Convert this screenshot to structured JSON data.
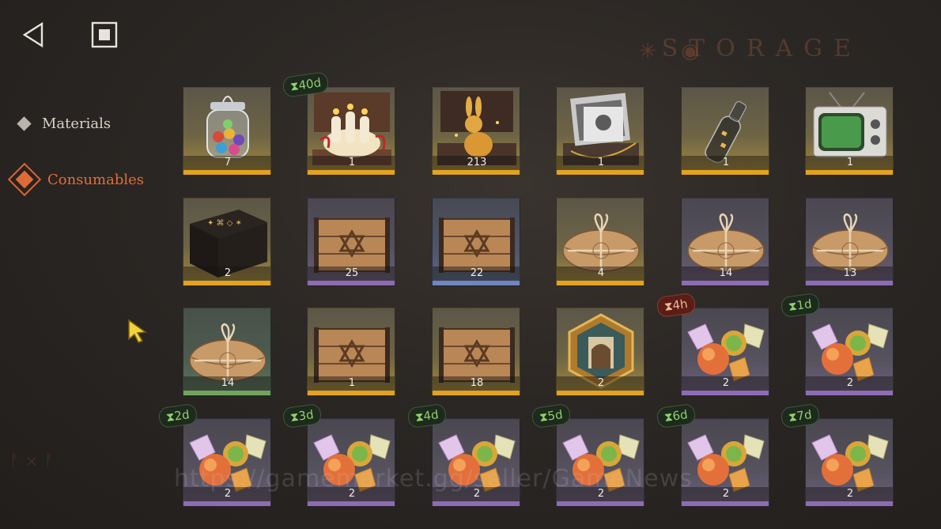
{
  "header": {
    "back_icon": "back-triangle-icon",
    "home_icon": "square-stop-icon",
    "title": "STORAGE"
  },
  "sidebar": {
    "items": [
      {
        "label": "Materials",
        "active": false
      },
      {
        "label": "Consumables",
        "active": true
      }
    ]
  },
  "colors": {
    "accent": "#e46d37",
    "rarity_gold": "#e3a21f",
    "rarity_purple": "#8e6cb4",
    "rarity_blue": "#6f86c0",
    "rarity_green": "#71a55c",
    "timer_green": "#8fd06b"
  },
  "items": [
    {
      "name": "jar-of-marbles",
      "count": "7",
      "rarity": "gold",
      "timer": ""
    },
    {
      "name": "candle-gift-box",
      "count": "1",
      "rarity": "gold",
      "timer": "⧗40d"
    },
    {
      "name": "golden-rabbit-box",
      "count": "213",
      "rarity": "gold",
      "timer": ""
    },
    {
      "name": "photo-box",
      "count": "1",
      "rarity": "gold",
      "timer": ""
    },
    {
      "name": "message-bottle",
      "count": "1",
      "rarity": "gold",
      "timer": ""
    },
    {
      "name": "old-television",
      "count": "1",
      "rarity": "gold",
      "timer": ""
    },
    {
      "name": "rune-table",
      "count": "2",
      "rarity": "gold",
      "timer": ""
    },
    {
      "name": "wooden-crate",
      "count": "25",
      "rarity": "purple",
      "timer": ""
    },
    {
      "name": "wooden-crate",
      "count": "22",
      "rarity": "blue",
      "timer": ""
    },
    {
      "name": "wrapped-parcel",
      "count": "4",
      "rarity": "gold",
      "timer": ""
    },
    {
      "name": "wrapped-parcel",
      "count": "14",
      "rarity": "purple",
      "timer": ""
    },
    {
      "name": "wrapped-parcel",
      "count": "13",
      "rarity": "purple",
      "timer": ""
    },
    {
      "name": "wrapped-parcel",
      "count": "14",
      "rarity": "green",
      "timer": ""
    },
    {
      "name": "wooden-crate",
      "count": "1",
      "rarity": "gold",
      "timer": ""
    },
    {
      "name": "wooden-crate",
      "count": "18",
      "rarity": "gold",
      "timer": ""
    },
    {
      "name": "hexagon-emblem",
      "count": "2",
      "rarity": "gold",
      "timer": ""
    },
    {
      "name": "candy-fruit",
      "count": "2",
      "rarity": "purple",
      "timer": "⧗4h",
      "timer_style": "red"
    },
    {
      "name": "candy-fruit",
      "count": "2",
      "rarity": "purple",
      "timer": "⧗1d"
    },
    {
      "name": "candy-fruit",
      "count": "2",
      "rarity": "purple",
      "timer": "⧗2d"
    },
    {
      "name": "candy-fruit",
      "count": "2",
      "rarity": "purple",
      "timer": "⧗3d"
    },
    {
      "name": "candy-fruit",
      "count": "2",
      "rarity": "purple",
      "timer": "⧗4d"
    },
    {
      "name": "candy-fruit",
      "count": "2",
      "rarity": "purple",
      "timer": "⧗5d"
    },
    {
      "name": "candy-fruit",
      "count": "2",
      "rarity": "purple",
      "timer": "⧗6d"
    },
    {
      "name": "candy-fruit",
      "count": "2",
      "rarity": "purple",
      "timer": "⧗7d"
    }
  ],
  "watermark": "https://gamemarket.gg/seller/GameNews"
}
